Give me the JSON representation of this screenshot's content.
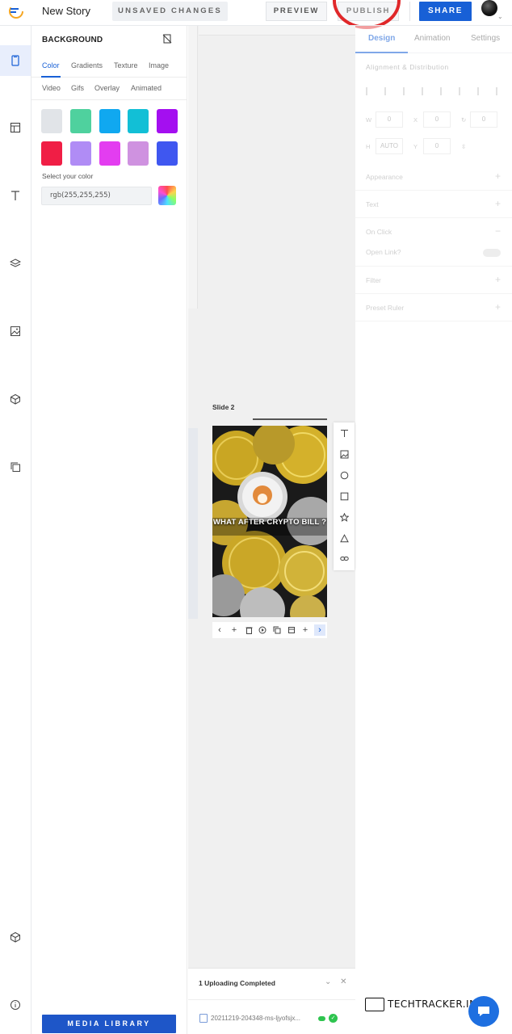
{
  "header": {
    "story_title": "New Story",
    "unsaved_label": "UNSAVED CHANGES",
    "preview_label": "PREVIEW",
    "publish_label": "PUBLISH",
    "share_label": "SHARE",
    "accent_color": "#1860d6",
    "highlight_color": "#e0282a"
  },
  "rail": {
    "items": [
      "background-icon",
      "templates-icon",
      "text-icon",
      "layers-icon",
      "image-icon",
      "elements-icon",
      "copy-icon"
    ],
    "bottom": [
      "box-icon",
      "info-icon"
    ]
  },
  "background_panel": {
    "title": "BACKGROUND",
    "tabs_row1": [
      "Color",
      "Gradients",
      "Texture",
      "Image"
    ],
    "tabs_row2": [
      "Video",
      "Gifs",
      "Overlay",
      "Animated"
    ],
    "active_tab": "Color",
    "swatches": [
      "#e1e4e8",
      "#4fd19e",
      "#10a8f0",
      "#12bfd6",
      "#a40ff0",
      "#f01e45",
      "#b08cf5",
      "#e33df0",
      "#cf92e0",
      "#3f57f0"
    ],
    "select_label": "Select your color",
    "color_value": "rgb(255,255,255)",
    "media_library_label": "MEDIA LIBRARY"
  },
  "canvas": {
    "slide_label": "Slide 2",
    "slide_text": "WHAT AFTER CRYPTO BILL ?",
    "toolbar": [
      "text-icon",
      "image-icon",
      "circle-icon",
      "square-icon",
      "star-icon",
      "triangle-icon",
      "link-icon"
    ],
    "controls": [
      "chevron-left-icon",
      "plus-icon",
      "trash-icon",
      "play-icon",
      "duplicate-icon",
      "copy-icon",
      "add-icon",
      "chevron-right-icon"
    ]
  },
  "upload": {
    "title": "1 Uploading Completed",
    "file_name": "20211219-204348-ms-ljyofsjx..."
  },
  "properties": {
    "tabs": [
      "Design",
      "Animation",
      "Settings"
    ],
    "active_tab": "Design",
    "alignment_title": "Alignment & Distribution",
    "fields": {
      "w_label": "W",
      "w_value": "0",
      "x_label": "X",
      "x_value": "0",
      "rot_value": "0",
      "h_label": "H",
      "h_value": "AUTO",
      "y_label": "Y",
      "y_value": "0"
    },
    "sections": [
      {
        "label": "Appearance",
        "symbol": "+"
      },
      {
        "label": "Text",
        "symbol": "+"
      },
      {
        "label": "On Click",
        "symbol": "−"
      },
      {
        "label": "Filter",
        "symbol": "+"
      },
      {
        "label": "Preset Ruler",
        "symbol": "+"
      }
    ],
    "open_link_label": "Open Link?"
  },
  "watermark": {
    "text": "TECHTRACKER.IN"
  }
}
